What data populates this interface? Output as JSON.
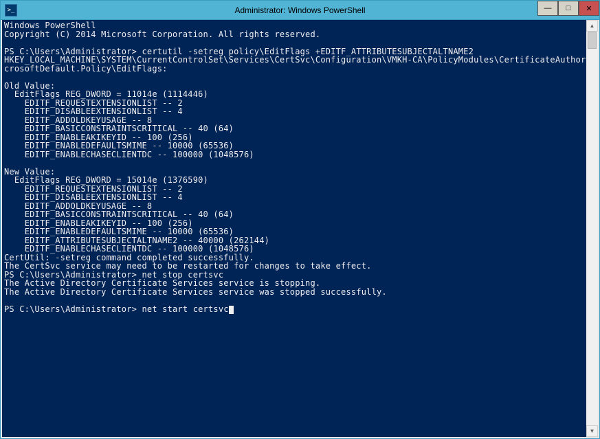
{
  "window": {
    "title": "Administrator: Windows PowerShell",
    "icon_char": ">_"
  },
  "controls": {
    "minimize": "—",
    "maximize": "□",
    "close": "✕"
  },
  "terminal": {
    "header1": "Windows PowerShell",
    "header2": "Copyright (C) 2014 Microsoft Corporation. All rights reserved.",
    "blank": "",
    "prompt_line1": "PS C:\\Users\\Administrator> certutil -setreg policy\\EditFlags +EDITF_ATTRIBUTESUBJECTALTNAME2",
    "reg_path": "HKEY_LOCAL_MACHINE\\SYSTEM\\CurrentControlSet\\Services\\CertSvc\\Configuration\\VMKH-CA\\PolicyModules\\CertificateAuthority_Mi",
    "reg_path2": "crosoftDefault.Policy\\EditFlags:",
    "old_value_hdr": "Old Value:",
    "old_editflags": "  EditFlags REG_DWORD = 11014e (1114446)",
    "old_l1": "    EDITF_REQUESTEXTENSIONLIST -- 2",
    "old_l2": "    EDITF_DISABLEEXTENSIONLIST -- 4",
    "old_l3": "    EDITF_ADDOLDKEYUSAGE -- 8",
    "old_l4": "    EDITF_BASICCONSTRAINTSCRITICAL -- 40 (64)",
    "old_l5": "    EDITF_ENABLEAKIKEYID -- 100 (256)",
    "old_l6": "    EDITF_ENABLEDEFAULTSMIME -- 10000 (65536)",
    "old_l7": "    EDITF_ENABLECHASECLIENTDC -- 100000 (1048576)",
    "new_value_hdr": "New Value:",
    "new_editflags": "  EditFlags REG_DWORD = 15014e (1376590)",
    "new_l1": "    EDITF_REQUESTEXTENSIONLIST -- 2",
    "new_l2": "    EDITF_DISABLEEXTENSIONLIST -- 4",
    "new_l3": "    EDITF_ADDOLDKEYUSAGE -- 8",
    "new_l4": "    EDITF_BASICCONSTRAINTSCRITICAL -- 40 (64)",
    "new_l5": "    EDITF_ENABLEAKIKEYID -- 100 (256)",
    "new_l6": "    EDITF_ENABLEDEFAULTSMIME -- 10000 (65536)",
    "new_l7": "    EDITF_ATTRIBUTESUBJECTALTNAME2 -- 40000 (262144)",
    "new_l8": "    EDITF_ENABLECHASECLIENTDC -- 100000 (1048576)",
    "result1": "CertUtil: -setreg command completed successfully.",
    "result2": "The CertSvc service may need to be restarted for changes to take effect.",
    "prompt_line2": "PS C:\\Users\\Administrator> net stop certsvc",
    "stop1": "The Active Directory Certificate Services service is stopping.",
    "stop2": "The Active Directory Certificate Services service was stopped successfully.",
    "prompt_line3": "PS C:\\Users\\Administrator> net start certsvc"
  },
  "scrollbar": {
    "up": "▲",
    "down": "▼"
  }
}
